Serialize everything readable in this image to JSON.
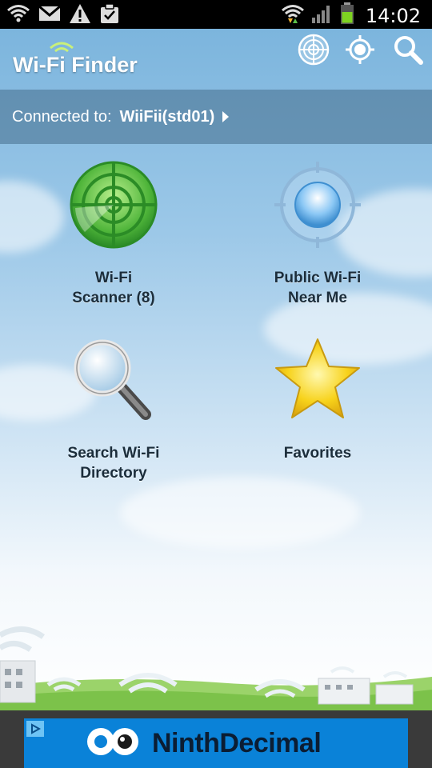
{
  "status_bar": {
    "time": "14:02",
    "left_icons": [
      "wifi-icon",
      "gmail-icon",
      "warning-icon",
      "clipboard-icon"
    ],
    "right_icons": [
      "wifi-transfer-icon",
      "signal-icon",
      "battery-icon"
    ]
  },
  "header": {
    "app_title": "Wi-Fi Finder",
    "actions": [
      "radar-icon",
      "locate-icon",
      "search-icon"
    ]
  },
  "connection": {
    "label": "Connected to:",
    "network": "WiiFii(std01)"
  },
  "tiles": {
    "scanner": {
      "line1": "Wi-Fi",
      "line2": "Scanner (8)",
      "icon": "radar-icon"
    },
    "public": {
      "line1": "Public Wi-Fi",
      "line2": "Near Me",
      "icon": "target-icon"
    },
    "search": {
      "line1": "Search Wi-Fi",
      "line2": "Directory",
      "icon": "magnifier-icon"
    },
    "favorites": {
      "line1": "Favorites",
      "icon": "star-icon"
    }
  },
  "ad": {
    "brand": "NinthDecimal",
    "brand_part1": "Ninth",
    "brand_part2": "Decimal"
  },
  "colors": {
    "status_bar": "#000000",
    "ad_blue": "#0a82d8",
    "radar_green": "#3aa63a",
    "star_yellow": "#f7d21a"
  }
}
